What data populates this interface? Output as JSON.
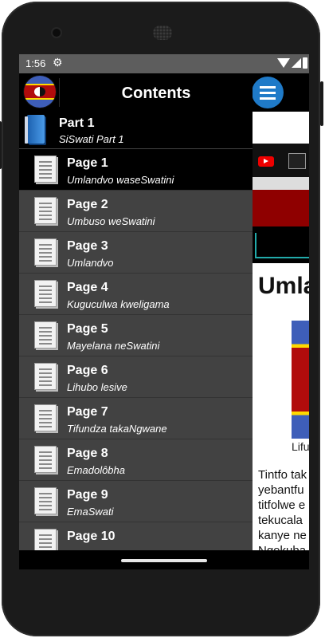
{
  "status_bar": {
    "time": "1:56",
    "icons": [
      "gear-icon",
      "wifi-icon",
      "signal-icon",
      "battery-icon"
    ]
  },
  "drawer": {
    "title": "Contents",
    "part": {
      "title": "Part 1",
      "subtitle": "SiSwati Part 1"
    },
    "pages": [
      {
        "title": "Page 1",
        "subtitle": "Umlandvo waseSwatini",
        "active": true
      },
      {
        "title": "Page 2",
        "subtitle": "Umbuso weSwatini"
      },
      {
        "title": "Page 3",
        "subtitle": "Umlandvo"
      },
      {
        "title": "Page 4",
        "subtitle": "Kuguculwa kweligama"
      },
      {
        "title": "Page 5",
        "subtitle": "Mayelana neSwatini"
      },
      {
        "title": "Page 6",
        "subtitle": "Lihubo lesive"
      },
      {
        "title": "Page 7",
        "subtitle": "Tifundza takaNgwane"
      },
      {
        "title": "Page 8",
        "subtitle": "Emadolôbha"
      },
      {
        "title": "Page 9",
        "subtitle": "EmaSwati"
      },
      {
        "title": "Page 10",
        "subtitle": ""
      }
    ]
  },
  "background_page": {
    "heading": "Umla",
    "image_caption": "Lifu",
    "paragraph_lines": [
      "Tintfo tak",
      "yebantfu",
      "titfolwe e",
      "tekucala",
      "kanye ne",
      "Ngokuba"
    ]
  },
  "colors": {
    "drawer_bg": "#424242",
    "header_bg": "#000000",
    "menu_button": "#1f7ac8",
    "status_bar": "#5d5d5d"
  }
}
